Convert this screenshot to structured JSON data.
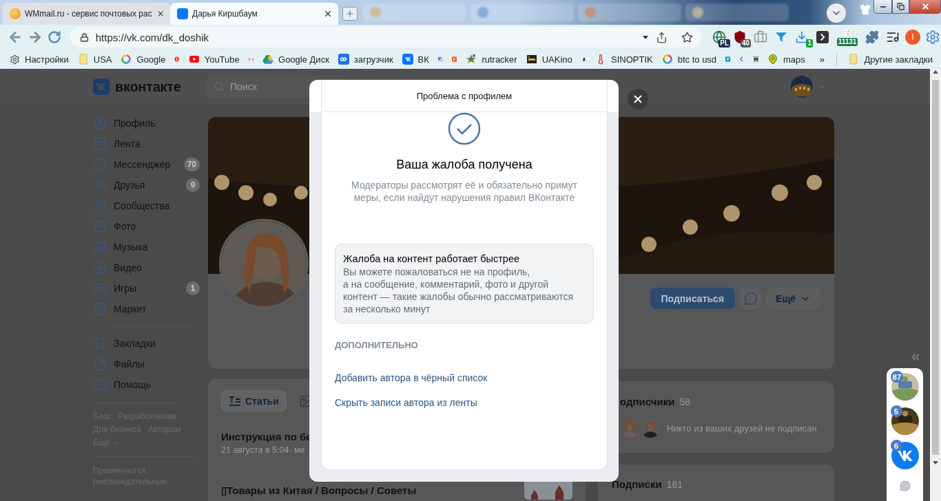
{
  "browser": {
    "tabs": [
      {
        "title": "WMmail.ru - сервис почтовых рас",
        "selected": false
      },
      {
        "title": "Дарья Киршбаум",
        "selected": true
      }
    ],
    "address": "https://vk.com/dk_doshik",
    "extension_badges": [
      "PL",
      "40",
      "1",
      "11131",
      "I"
    ],
    "bookmarks": [
      "Настройки",
      "USA",
      "Google",
      "YouTube",
      "Google Диск",
      "загрузчик",
      "ВК",
      "rutracker",
      "UAKino",
      "SINOPTIK",
      "btc to usd",
      "maps"
    ],
    "more_bookmarks": "»",
    "other_bookmarks": "Другие закладки"
  },
  "vk": {
    "logo": "вконтакте",
    "search_placeholder": "Поиск",
    "nav": [
      {
        "label": "Профиль"
      },
      {
        "label": "Лента"
      },
      {
        "label": "Мессенджер",
        "count": "70"
      },
      {
        "label": "Друзья",
        "count": "9"
      },
      {
        "label": "Сообщества"
      },
      {
        "label": "Фото"
      },
      {
        "label": "Музыка"
      },
      {
        "label": "Видео"
      },
      {
        "label": "Игры",
        "count": "1"
      },
      {
        "label": "Маркет"
      }
    ],
    "nav_secondary": [
      {
        "label": "Закладки"
      },
      {
        "label": "Файлы"
      },
      {
        "label": "Помощь"
      }
    ],
    "footer_links": [
      "Блог",
      "Разработчикам",
      "Для бизнеса",
      "Авторам",
      "Ещё"
    ],
    "footer_note": "Применяются рекомендательные",
    "profile": {
      "subscribe": "Подписаться",
      "more": "Ещё"
    },
    "posts": {
      "tabs": [
        {
          "label": "Статьи",
          "selected": true
        }
      ],
      "items": [
        {
          "title": "Инструкция по бе",
          "meta": "21 августа в 5:04· ме"
        },
        {
          "title": "▯Товары из Китая / Вопросы / Советы"
        }
      ]
    },
    "subscribers": {
      "title": "одписчики",
      "count": "58",
      "note": "Никто из ваших друзей не подписан"
    },
    "subscriptions": {
      "title": "Подписки",
      "count": "161"
    },
    "chats": [
      {
        "count": "87"
      },
      {
        "count": "5"
      },
      {
        "count": "6"
      }
    ]
  },
  "modal": {
    "title": "Проблема с профилем",
    "heading": "Ваша жалоба получена",
    "text": "Модераторы рассмотрят её и обязательно примут меры, если найдут нарушения правил ВКонтакте",
    "tip": {
      "title": "Жалоба на контент работает быстрее",
      "text": "Вы можете пожаловаться не на профиль,\nа на сообщение, комментарий, фото и другой\nконтент — такие жалобы обычно рассматриваются\nза несколько минут"
    },
    "section": "ДОПОЛНИТЕЛЬНО",
    "links": [
      "Добавить автора в чёрный список",
      "Скрыть записи автора из ленты"
    ]
  }
}
